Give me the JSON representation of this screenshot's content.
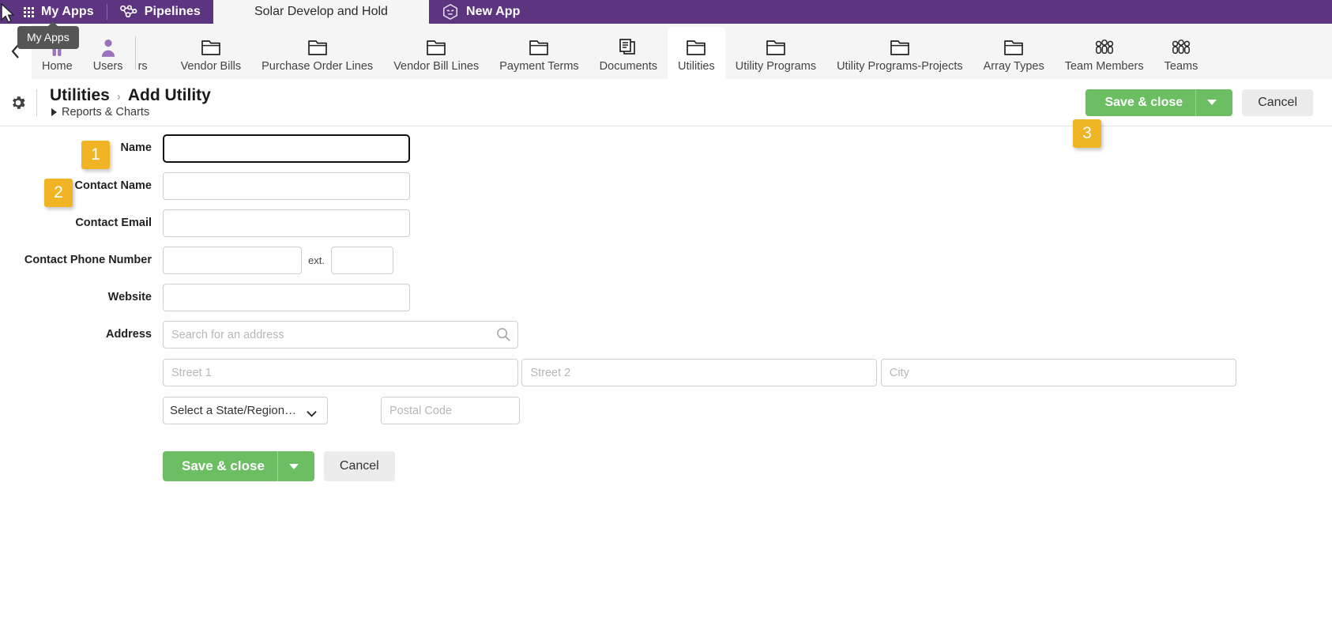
{
  "topbar": {
    "my_apps": "My Apps",
    "pipelines": "Pipelines",
    "active_tab": "Solar Develop and Hold",
    "new_app": "New App",
    "bg_color": "#5c3480"
  },
  "tooltip": {
    "text": "My Apps"
  },
  "nav": {
    "collapse_glyph": "‹",
    "items": [
      {
        "label": "Home",
        "icon": "home-icon",
        "active": false
      },
      {
        "label": "Users",
        "icon": "users-icon",
        "active": false
      },
      {
        "label": "ders",
        "icon": "folder-icon",
        "active": false,
        "clipped": true
      },
      {
        "label": "Vendor Bills",
        "icon": "folder-icon",
        "active": false
      },
      {
        "label": "Purchase Order Lines",
        "icon": "folder-icon",
        "active": false
      },
      {
        "label": "Vendor Bill Lines",
        "icon": "folder-icon",
        "active": false
      },
      {
        "label": "Payment Terms",
        "icon": "folder-icon",
        "active": false
      },
      {
        "label": "Documents",
        "icon": "documents-icon",
        "active": false
      },
      {
        "label": "Utilities",
        "icon": "folder-icon",
        "active": true
      },
      {
        "label": "Utility Programs",
        "icon": "folder-icon",
        "active": false
      },
      {
        "label": "Utility Programs-Projects",
        "icon": "folder-icon",
        "active": false
      },
      {
        "label": "Array Types",
        "icon": "folder-icon",
        "active": false
      },
      {
        "label": "Team Members",
        "icon": "team-icon",
        "active": false
      },
      {
        "label": "Teams",
        "icon": "team-icon",
        "active": false
      }
    ]
  },
  "header": {
    "breadcrumb_parent": "Utilities",
    "breadcrumb_sep": "›",
    "breadcrumb_current": "Add Utility",
    "reports_charts": "Reports & Charts",
    "save_label": "Save & close",
    "cancel_label": "Cancel",
    "save_color": "#6cbe63"
  },
  "badges": [
    {
      "number": "1",
      "color": "#efb524"
    },
    {
      "number": "2",
      "color": "#efb524"
    },
    {
      "number": "3",
      "color": "#efb524"
    }
  ],
  "form": {
    "fields": {
      "name": {
        "label": "Name",
        "value": "",
        "placeholder": ""
      },
      "contact_name": {
        "label": "Contact Name",
        "value": "",
        "placeholder": ""
      },
      "contact_email": {
        "label": "Contact Email",
        "value": "",
        "placeholder": ""
      },
      "contact_phone": {
        "label": "Contact Phone Number",
        "value": "",
        "placeholder": "",
        "ext_label": "ext.",
        "ext_value": ""
      },
      "website": {
        "label": "Website",
        "value": "",
        "placeholder": ""
      },
      "address": {
        "label": "Address",
        "search_placeholder": "Search for an address",
        "street1_placeholder": "Street 1",
        "street2_placeholder": "Street 2",
        "city_placeholder": "City",
        "state_selected": "Select a State/Region…",
        "postal_placeholder": "Postal Code"
      }
    },
    "save_label": "Save & close",
    "cancel_label": "Cancel"
  }
}
